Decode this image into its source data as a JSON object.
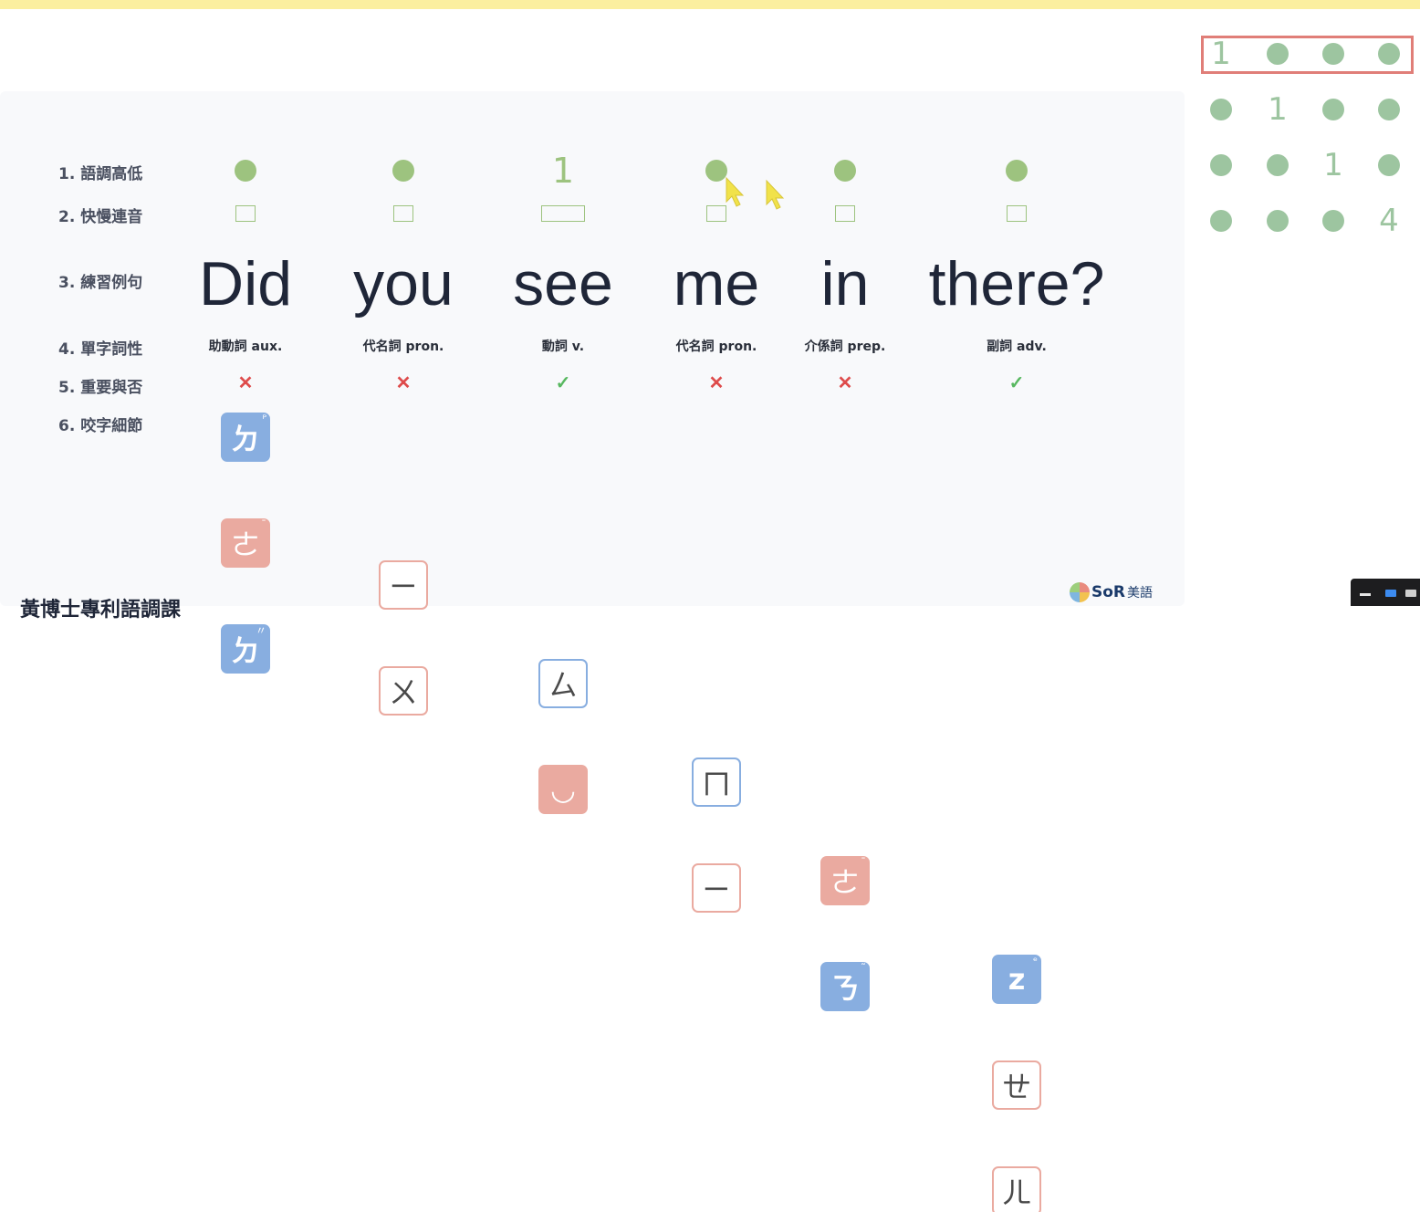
{
  "row_labels": [
    "1. 語調高低",
    "2. 快慢連音",
    "3. 練習例句",
    "4. 單字詞性",
    "5. 重要與否",
    "6. 咬字細節"
  ],
  "words": [
    {
      "word": "Did",
      "tone": "dot",
      "tone_label": "",
      "pos": "助動詞 aux.",
      "important": "✕",
      "is_important": false,
      "tiles": [
        {
          "char": "ㄉ",
          "sup": "ᴾ",
          "style": "blue"
        },
        {
          "char": "ㄜ",
          "sup": "ˉ",
          "style": "pink"
        },
        {
          "char": "ㄉ",
          "sup": "〃",
          "style": "blue"
        }
      ]
    },
    {
      "word": "you",
      "tone": "dot",
      "tone_label": "",
      "pos": "代名詞 pron.",
      "important": "✕",
      "is_important": false,
      "tiles": [
        {
          "char": "ㄧ",
          "sup": "",
          "style": "outp"
        },
        {
          "char": "ㄨ",
          "sup": "",
          "style": "outp"
        }
      ]
    },
    {
      "word": "see",
      "tone": "number",
      "tone_label": "1",
      "pos": "動詞 v.",
      "important": "✓",
      "is_important": true,
      "tiles": [
        {
          "char": "ㄙ",
          "sup": "",
          "style": "outb"
        },
        {
          "char": "◡",
          "sup": "",
          "style": "pink"
        }
      ]
    },
    {
      "word": "me",
      "tone": "dot",
      "tone_label": "",
      "pos": "代名詞 pron.",
      "important": "✕",
      "is_important": false,
      "tiles": [
        {
          "char": "ㄇ",
          "sup": "",
          "style": "outb"
        },
        {
          "char": "ㄧ",
          "sup": "",
          "style": "outp"
        }
      ]
    },
    {
      "word": "in",
      "tone": "dot",
      "tone_label": "",
      "pos": "介係詞 prep.",
      "important": "✕",
      "is_important": false,
      "tiles": [
        {
          "char": "ㄜ",
          "sup": "ˉ",
          "style": "pink"
        },
        {
          "char": "ㄋ",
          "sup": "˜",
          "style": "blue"
        }
      ]
    },
    {
      "word": "there?",
      "tone": "dot",
      "tone_label": "",
      "pos": "副詞 adv.",
      "important": "✓",
      "is_important": true,
      "tiles": [
        {
          "char": "z",
          "sup": "ᵉ",
          "style": "blue"
        },
        {
          "char": "ㄝ",
          "sup": "",
          "style": "outp"
        },
        {
          "char": "ㄦ",
          "sup": "",
          "style": "outp"
        }
      ]
    }
  ],
  "tone_grid": [
    [
      "1",
      "",
      "",
      ""
    ],
    [
      "",
      "1",
      "",
      ""
    ],
    [
      "",
      "",
      "1",
      ""
    ],
    [
      "",
      "",
      "",
      "4"
    ]
  ],
  "selected_grid_row": 0,
  "footer_title": "黃博士專利語調課",
  "logo": {
    "main": "SoR",
    "sub": "美語"
  },
  "colors": {
    "tone_green": "#9dc37f",
    "wrong_red": "#de4b4b",
    "right_green": "#58b860",
    "highlight_frame": "#e07e78",
    "top_bar": "#fbef9f"
  }
}
